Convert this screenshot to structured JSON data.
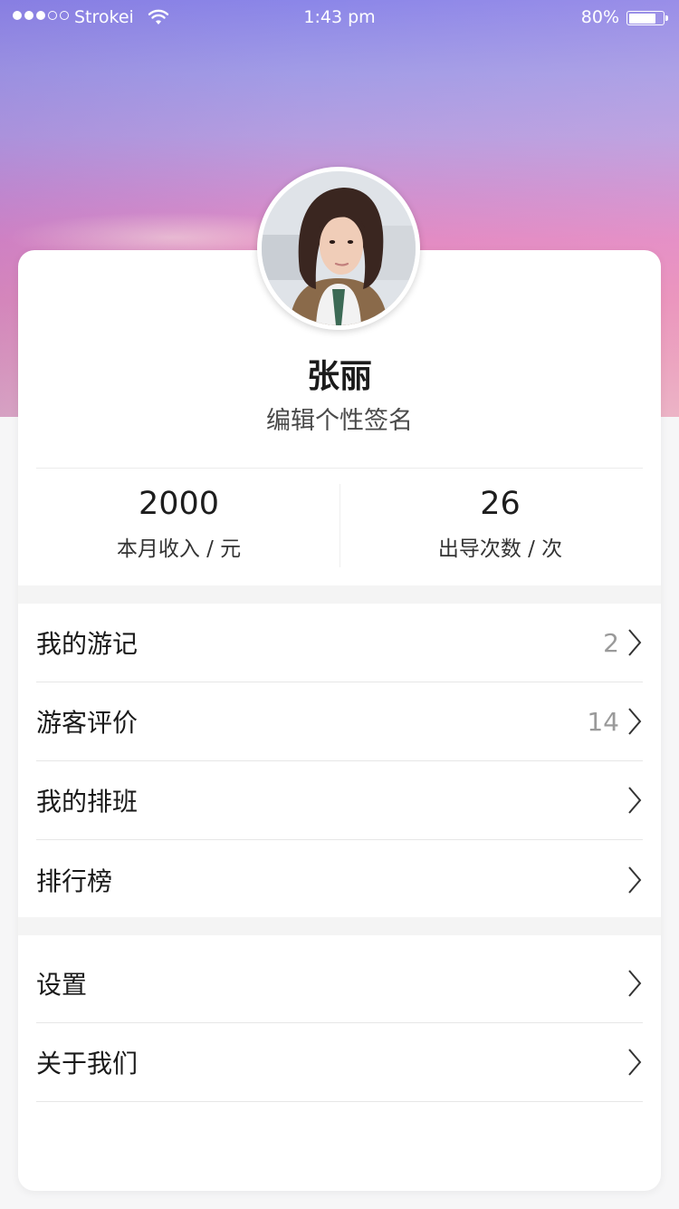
{
  "status_bar": {
    "carrier": "Strokei",
    "time": "1:43 pm",
    "battery": "80%"
  },
  "profile": {
    "name": "张丽",
    "signature": "编辑个性签名"
  },
  "stats": [
    {
      "value": "2000",
      "label": "本月收入 / 元"
    },
    {
      "value": "26",
      "label": "出导次数 / 次"
    }
  ],
  "menu_group_1": [
    {
      "label": "我的游记",
      "count": "2"
    },
    {
      "label": "游客评价",
      "count": "14"
    },
    {
      "label": "我的排班",
      "count": ""
    },
    {
      "label": "排行榜",
      "count": ""
    }
  ],
  "menu_group_2": [
    {
      "label": "设置"
    },
    {
      "label": "关于我们"
    }
  ],
  "colors": {
    "hero_top": "#8b86e8",
    "hero_bottom": "#eab1c2",
    "text_primary": "#1a1a1a",
    "text_muted": "#9a9a9a"
  },
  "icons": [
    "wifi-icon",
    "battery-icon",
    "chevron-right-icon",
    "avatar-photo"
  ]
}
